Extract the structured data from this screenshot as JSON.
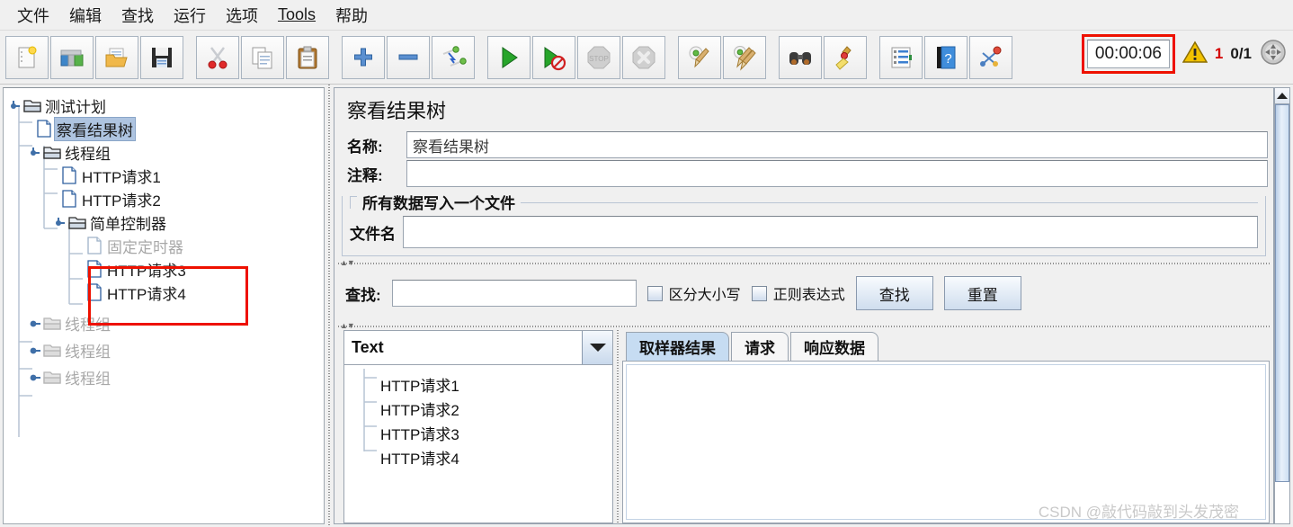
{
  "app": {
    "watermark": "CSDN @敲代码敲到头发茂密"
  },
  "menubar": {
    "items": [
      {
        "label": "文件",
        "name": "menu-file"
      },
      {
        "label": "编辑",
        "name": "menu-edit"
      },
      {
        "label": "查找",
        "name": "menu-search"
      },
      {
        "label": "运行",
        "name": "menu-run"
      },
      {
        "label": "选项",
        "name": "menu-options"
      },
      {
        "label": "Tools",
        "name": "menu-tools",
        "mnemonic": "T"
      },
      {
        "label": "帮助",
        "name": "menu-help"
      }
    ]
  },
  "toolbar": {
    "buttons": [
      {
        "name": "new-button",
        "icon": "new-document-icon"
      },
      {
        "name": "templates-button",
        "icon": "templates-icon"
      },
      {
        "name": "open-button",
        "icon": "open-folder-icon"
      },
      {
        "name": "save-button",
        "icon": "save-floppy-icon"
      },
      {
        "name": "cut-button",
        "icon": "scissors-icon"
      },
      {
        "name": "copy-button",
        "icon": "copy-icon"
      },
      {
        "name": "paste-button",
        "icon": "clipboard-icon"
      },
      {
        "name": "expand-all-button",
        "icon": "plus-icon"
      },
      {
        "name": "collapse-all-button",
        "icon": "minus-icon"
      },
      {
        "name": "toggle-button",
        "icon": "toggle-pins-icon"
      },
      {
        "name": "start-button",
        "icon": "play-icon"
      },
      {
        "name": "start-no-pauses-button",
        "icon": "play-no-pause-icon"
      },
      {
        "name": "stop-button",
        "icon": "stop-icon",
        "disabled": true
      },
      {
        "name": "shutdown-button",
        "icon": "shutdown-icon",
        "disabled": true
      },
      {
        "name": "clear-button",
        "icon": "clear-broom-icon"
      },
      {
        "name": "clear-all-button",
        "icon": "clear-all-brooms-icon"
      },
      {
        "name": "search-button",
        "icon": "binoculars-icon"
      },
      {
        "name": "reset-search-button",
        "icon": "yellow-broom-icon"
      },
      {
        "name": "function-helper-button",
        "icon": "function-list-icon"
      },
      {
        "name": "help-button",
        "icon": "help-book-icon"
      },
      {
        "name": "undo-redo-button",
        "icon": "network-nodes-icon"
      }
    ],
    "status": {
      "timer": "00:00:06",
      "warning_count": "1",
      "thread_count": "0/1",
      "warning_icon": "warning-triangle-icon",
      "remote_icon": "remote-sphere-icon",
      "timer_highlight_color": "#ee1100"
    }
  },
  "tree": {
    "nodes": [
      {
        "label": "测试计划",
        "icon": "folder-icon",
        "depth": 0,
        "handle": "expanded",
        "state": "normal"
      },
      {
        "label": "察看结果树",
        "icon": "file-icon",
        "depth": 1,
        "handle": "leaf",
        "state": "selected"
      },
      {
        "label": "线程组",
        "icon": "folder-icon",
        "depth": 1,
        "handle": "expanded",
        "state": "normal"
      },
      {
        "label": "HTTP请求1",
        "icon": "file-icon",
        "depth": 2,
        "handle": "leaf",
        "state": "normal"
      },
      {
        "label": "HTTP请求2",
        "icon": "file-icon",
        "depth": 2,
        "handle": "leaf",
        "state": "normal"
      },
      {
        "label": "简单控制器",
        "icon": "folder-icon",
        "depth": 2,
        "handle": "expanded",
        "state": "normal"
      },
      {
        "label": "固定定时器",
        "icon": "file-icon",
        "depth": 3,
        "handle": "leaf",
        "state": "disabled"
      },
      {
        "label": "HTTP请求3",
        "icon": "file-icon",
        "depth": 3,
        "handle": "leaf",
        "state": "normal"
      },
      {
        "label": "HTTP请求4",
        "icon": "file-icon",
        "depth": 3,
        "handle": "leaf",
        "state": "normal"
      },
      {
        "label": "线程组",
        "icon": "folder-icon",
        "depth": 1,
        "handle": "collapsed",
        "state": "disabled"
      },
      {
        "label": "线程组",
        "icon": "folder-icon",
        "depth": 1,
        "handle": "collapsed",
        "state": "disabled"
      },
      {
        "label": "线程组",
        "icon": "folder-icon",
        "depth": 1,
        "handle": "collapsed",
        "state": "disabled"
      }
    ],
    "highlight_color": "#ee1100"
  },
  "panel": {
    "title": "察看结果树",
    "name_label": "名称:",
    "name_value": "察看结果树",
    "comment_label": "注释:",
    "comment_value": "",
    "group_title": "所有数据写入一个文件",
    "filename_label": "文件名",
    "filename_value": ""
  },
  "search": {
    "label": "查找:",
    "value": "",
    "case_sensitive_label": "区分大小写",
    "case_sensitive_checked": false,
    "regex_label": "正则表达式",
    "regex_checked": false,
    "find_button": "查找",
    "reset_button": "重置"
  },
  "results": {
    "renderer_selected": "Text",
    "items": [
      {
        "label": "HTTP请求1"
      },
      {
        "label": "HTTP请求2"
      },
      {
        "label": "HTTP请求3"
      },
      {
        "label": "HTTP请求4"
      }
    ]
  },
  "tabs": [
    {
      "label": "取样器结果",
      "active": true,
      "name": "tab-sampler-result"
    },
    {
      "label": "请求",
      "active": false,
      "name": "tab-request"
    },
    {
      "label": "响应数据",
      "active": false,
      "name": "tab-response-data"
    }
  ]
}
